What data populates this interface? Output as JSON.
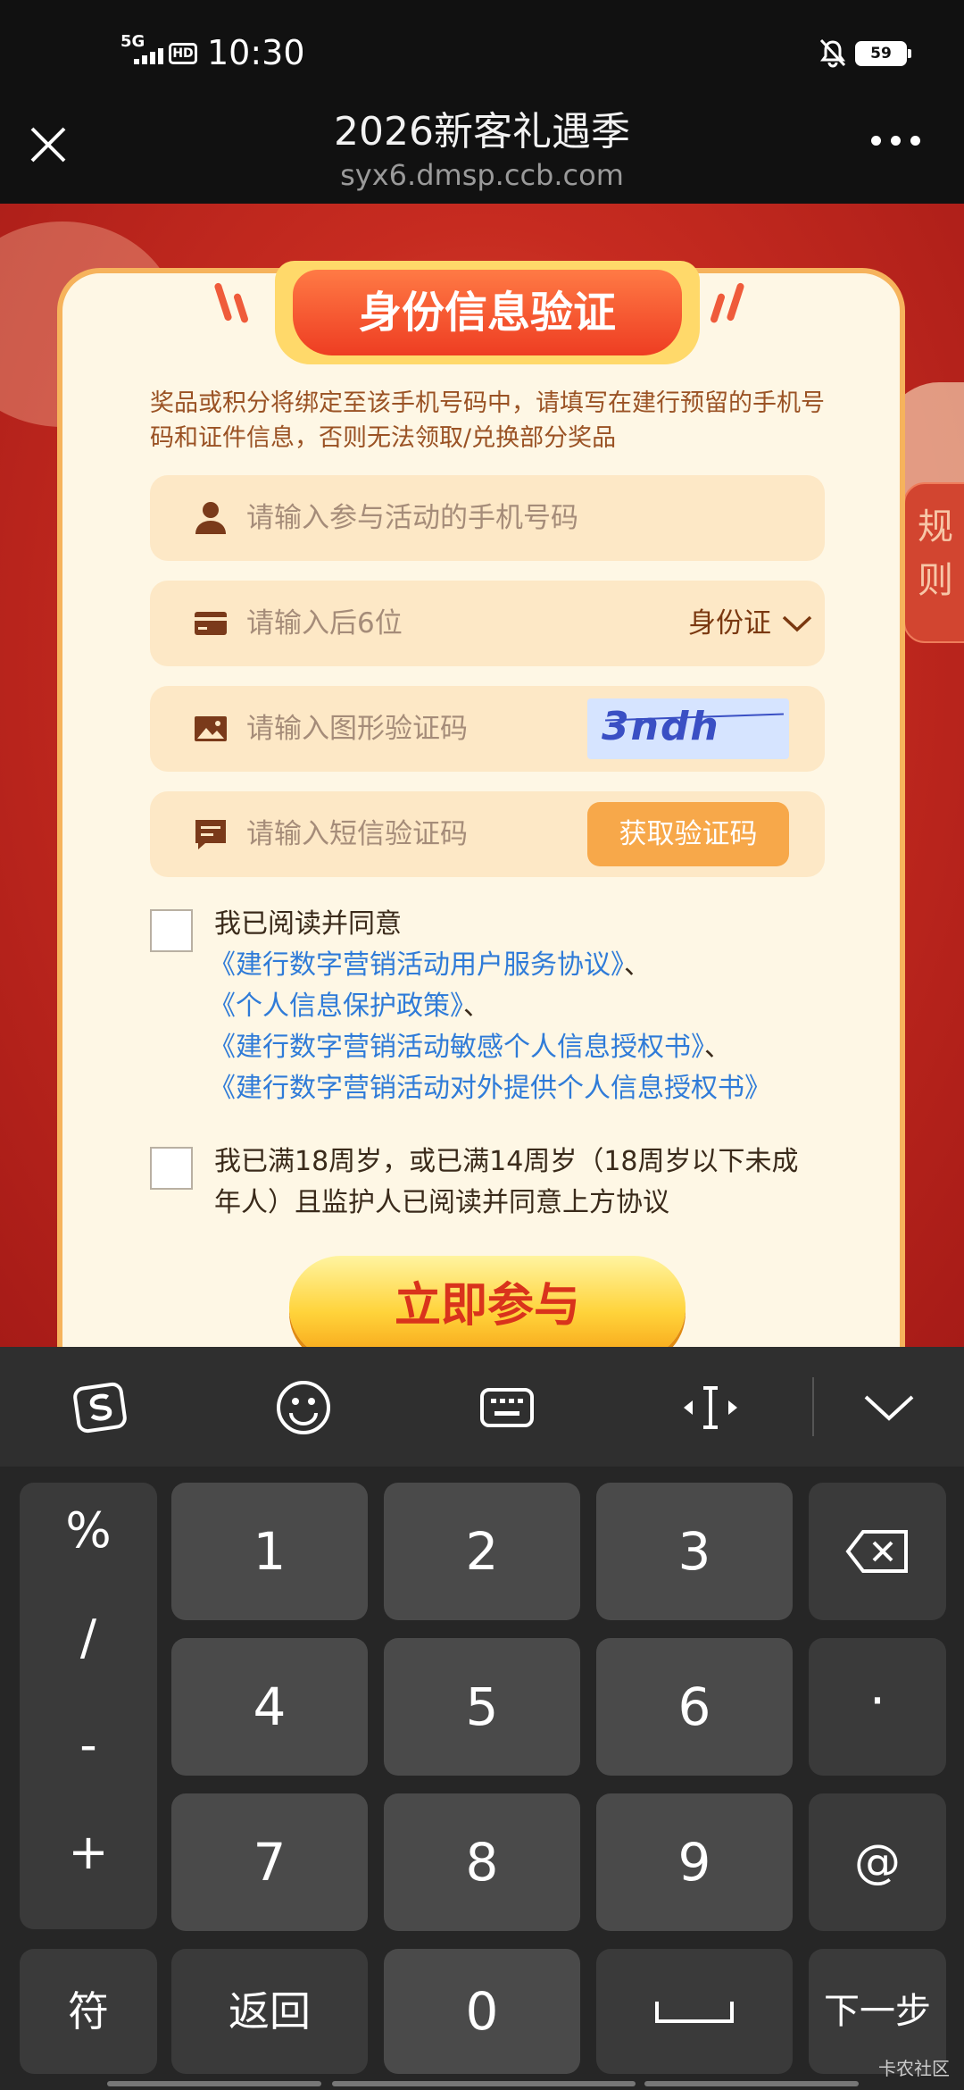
{
  "status_bar": {
    "network": "5G",
    "hd": "HD",
    "time": "10:30",
    "battery": "59",
    "icons": [
      "signal-icon",
      "hd-icon",
      "mute-icon",
      "battery-icon"
    ]
  },
  "navbar": {
    "title": "2026新客礼遇季",
    "url": "syx6.dmsp.ccb.com"
  },
  "side_tab": {
    "label": "规则"
  },
  "card": {
    "title": "身份信息验证",
    "notice": "奖品或积分将绑定至该手机号码中，请填写在建行预留的手机号码和证件信息，否则无法领取/兑换部分奖品",
    "phone": {
      "placeholder": "请输入参与活动的手机号码"
    },
    "id": {
      "placeholder": "请输入后6位",
      "type_label": "身份证"
    },
    "captcha": {
      "placeholder": "请输入图形验证码",
      "code": "3ndh"
    },
    "sms": {
      "placeholder": "请输入短信验证码",
      "button": "获取验证码"
    },
    "agree": {
      "lead": "我已阅读并同意",
      "links": [
        {
          "text": "《建行数字营销活动用户服务协议》",
          "sep": "、"
        },
        {
          "text": "《个人信息保护政策》",
          "sep": "、"
        },
        {
          "text": "《建行数字营销活动敏感个人信息授权书》",
          "sep": "、"
        },
        {
          "text": "《建行数字营销活动对外提供个人信息授权书》",
          "sep": ""
        }
      ]
    },
    "age": {
      "line1": "我已满18周岁，或已满14周岁（18周岁以下未成",
      "line2": "年人）且监护人已阅读并同意上方协议"
    },
    "join_button": "立即参与"
  },
  "keyboard": {
    "symbols": [
      "%",
      "/",
      "-",
      "+"
    ],
    "rows": [
      [
        "1",
        "2",
        "3"
      ],
      [
        "4",
        "5",
        "6"
      ],
      [
        "7",
        "8",
        "9"
      ]
    ],
    "right_keys": [
      "·",
      "@"
    ],
    "bottom": {
      "sym": "符",
      "back": "返回",
      "zero": "0",
      "next": "下一步"
    }
  },
  "watermark": "卡农社区"
}
